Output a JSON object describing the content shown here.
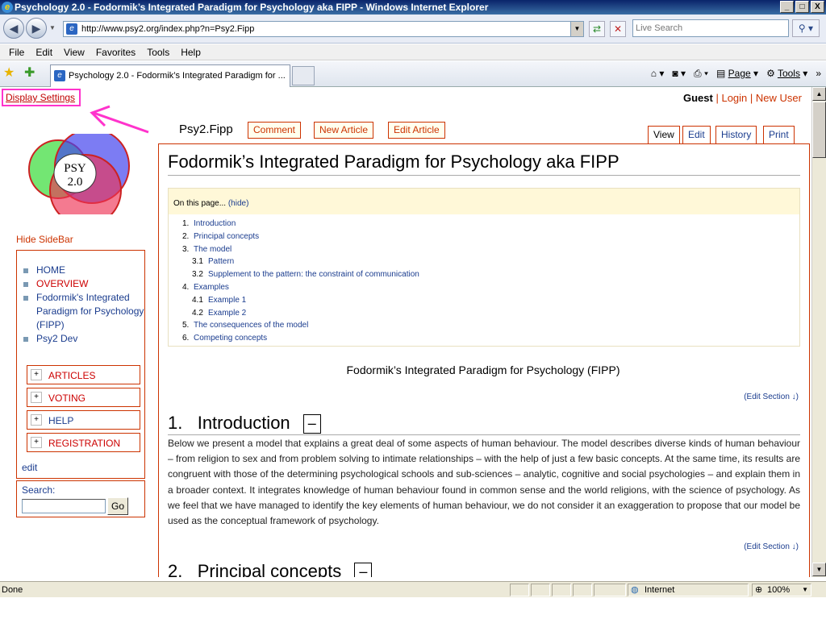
{
  "window": {
    "title": "Psychology 2.0 - Fodormik’s Integrated Paradigm for Psychology aka FIPP - Windows Internet Explorer",
    "controls": [
      "_",
      "□",
      "X"
    ]
  },
  "address": {
    "url": "http://www.psy2.org/index.php?n=Psy2.Fipp",
    "search_placeholder": "Live Search"
  },
  "menu": [
    "File",
    "Edit",
    "View",
    "Favorites",
    "Tools",
    "Help"
  ],
  "tab": {
    "title": "Psychology 2.0 - Fodormik’s Integrated Paradigm for ..."
  },
  "commandbar": {
    "page": "Page",
    "tools": "Tools"
  },
  "page": {
    "display_settings": "Display Settings",
    "user": {
      "guest": "Guest",
      "login": "Login",
      "sep": "|",
      "new_user": "New User"
    },
    "logo_text": {
      "line1": "PSY",
      "line2": "2.0"
    },
    "hide_sidebar": "Hide SideBar",
    "sidebar_links": [
      "HOME",
      "OVERVIEW",
      "Fodormik's Integrated Paradigm for Psychology (FIPP)",
      "Psy2 Dev"
    ],
    "categories": [
      "ARTICLES",
      "VOTING",
      "HELP",
      "REGISTRATION"
    ],
    "sidebar_edit": "edit",
    "search_label": "Search:",
    "go": "Go",
    "pagename": "Psy2.Fipp",
    "actions": [
      "Comment",
      "New Article",
      "Edit Article"
    ],
    "tabs": [
      "View",
      "Edit",
      "History",
      "Print"
    ],
    "heading": "Fodormik’s Integrated Paradigm for Psychology aka FIPP",
    "toc_head": "On this page...",
    "toc_hide": "(hide)",
    "toc": [
      {
        "n": "1.",
        "t": "Introduction",
        "sub": false
      },
      {
        "n": "2.",
        "t": "Principal concepts",
        "sub": false
      },
      {
        "n": "3.",
        "t": "The model",
        "sub": false
      },
      {
        "n": "3.1",
        "t": "Pattern",
        "sub": true
      },
      {
        "n": "3.2",
        "t": "Supplement to the pattern: the constraint of communication",
        "sub": true
      },
      {
        "n": "4.",
        "t": "Examples",
        "sub": false
      },
      {
        "n": "4.1",
        "t": "Example 1",
        "sub": true
      },
      {
        "n": "4.2",
        "t": "Example 2",
        "sub": true
      },
      {
        "n": "5.",
        "t": "The consequences of the model",
        "sub": false
      },
      {
        "n": "6.",
        "t": "Competing concepts",
        "sub": false
      }
    ],
    "caption": "Fodormik’s Integrated Paradigm for Psychology (FIPP)",
    "edit_section": "(Edit Section ↓)",
    "sec1_num": "1.",
    "sec1_title": "Introduction",
    "collapse": "–",
    "sec1_text": "Below we present a model that explains a great deal of some aspects of human behaviour. The model describes diverse kinds of human behaviour – from religion to sex and from problem solving to intimate relationships – with the help of just a few basic concepts. At the same time, its results are congruent with those of the determining psychological schools and sub-sciences – analytic, cognitive and social psychologies – and explain them in a broader context. It integrates knowledge of human behaviour found in common sense and the world religions, with the science of psychology. As we feel that we have managed to identify the key elements of human behaviour, we do not consider it an exaggeration to propose that our model be used as the conceptual framework of psychology.",
    "sec2_num": "2.",
    "sec2_title": "Principal concepts"
  },
  "status": {
    "text": "Done",
    "zone": "Internet",
    "zoom": "100%"
  }
}
